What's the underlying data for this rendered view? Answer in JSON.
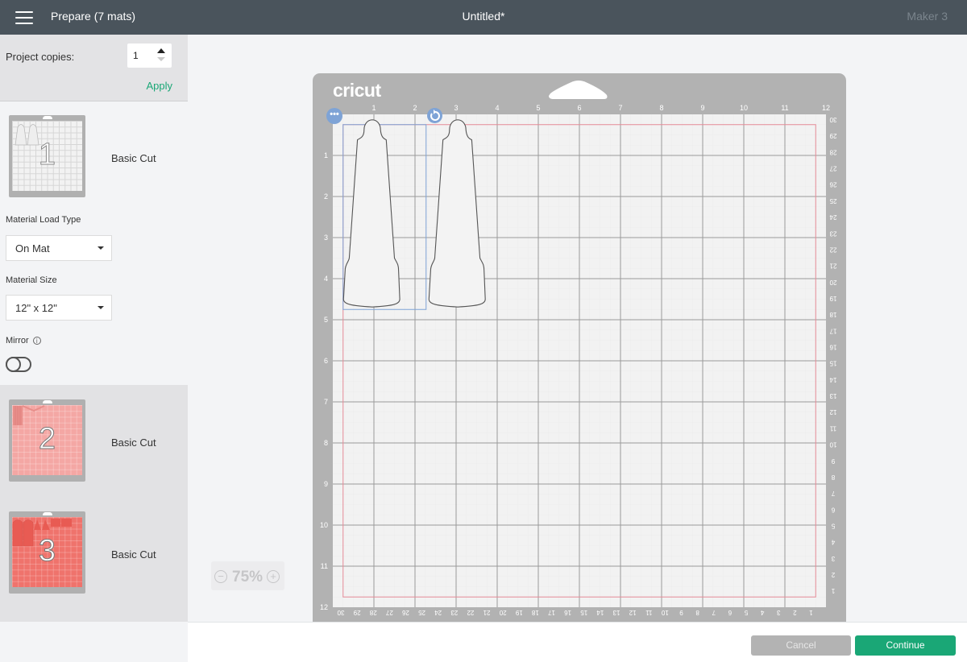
{
  "header": {
    "menu_icon": "hamburger-menu-icon",
    "title": "Prepare (7 mats)",
    "document_title": "Untitled*",
    "machine": "Maker 3"
  },
  "sidebar": {
    "project_copies_label": "Project copies:",
    "project_copies_value": "1",
    "apply_label": "Apply",
    "mats": [
      {
        "number": "1",
        "label": "Basic Cut",
        "material_color": "#f2f2f2",
        "selected": true
      },
      {
        "number": "2",
        "label": "Basic Cut",
        "material_color": "#f4a7a4",
        "selected": false
      },
      {
        "number": "3",
        "label": "Basic Cut",
        "material_color": "#ef736c",
        "selected": false
      }
    ],
    "material_load_type_label": "Material Load Type",
    "material_load_type_value": "On Mat",
    "material_size_label": "Material Size",
    "material_size_value": "12\" x 12\"",
    "mirror_label": "Mirror",
    "mirror_info_icon": "i",
    "mirror_on": false
  },
  "canvas": {
    "brand": "cricut",
    "zoom_out_icon": "−",
    "zoom_level": "75%",
    "zoom_in_icon": "+",
    "top_ruler": [
      "1",
      "2",
      "3",
      "4",
      "5",
      "6",
      "7",
      "8",
      "9",
      "10",
      "11",
      "12"
    ],
    "left_ruler": [
      "1",
      "2",
      "3",
      "4",
      "5",
      "6",
      "7",
      "8",
      "9",
      "10",
      "11",
      "12"
    ],
    "right_ruler_cm": [
      "30",
      "29",
      "28",
      "27",
      "26",
      "25",
      "24",
      "23",
      "22",
      "21",
      "20",
      "19",
      "18",
      "17",
      "16",
      "15",
      "14",
      "13",
      "12",
      "11",
      "10",
      "9",
      "8",
      "7",
      "6",
      "5",
      "4",
      "3",
      "2",
      "1"
    ],
    "bottom_ruler_cm": [
      "30",
      "29",
      "28",
      "27",
      "26",
      "25",
      "24",
      "23",
      "22",
      "21",
      "20",
      "19",
      "18",
      "17",
      "16",
      "15",
      "14",
      "13",
      "12",
      "11",
      "10",
      "9",
      "8",
      "7",
      "6",
      "5",
      "4",
      "3",
      "2",
      "1"
    ],
    "more_icon": "•••",
    "rotate_icon": "rotate-icon",
    "accent_color": "#7ea3d6",
    "cut_boundary_color": "#e58a96"
  },
  "footer": {
    "cancel_label": "Cancel",
    "continue_label": "Continue",
    "continue_color": "#1aa776"
  }
}
